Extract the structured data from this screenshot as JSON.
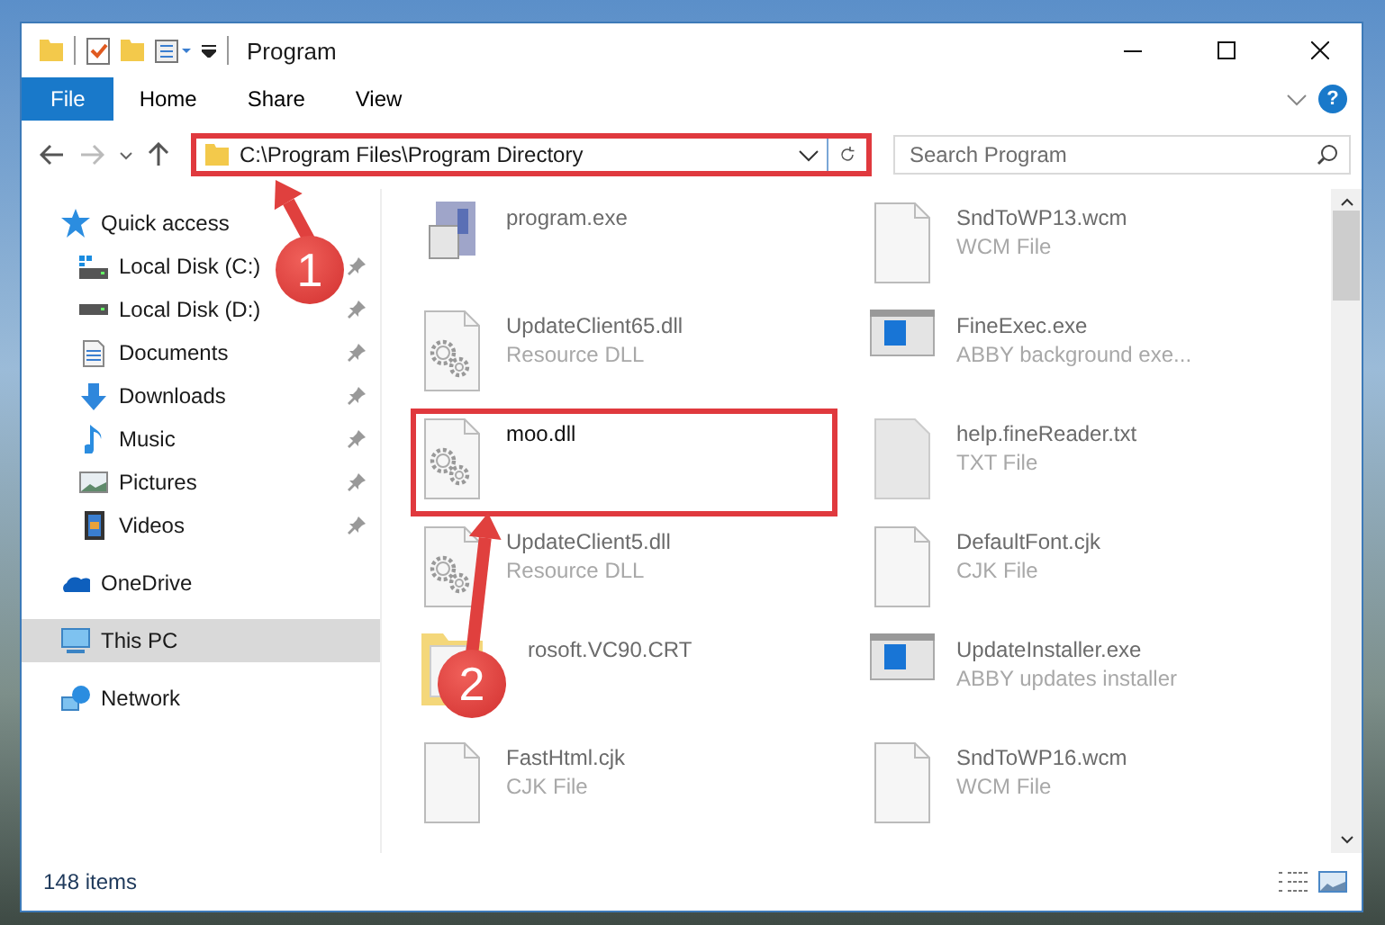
{
  "window": {
    "title": "Program",
    "help": "?"
  },
  "ribbon_tabs": [
    {
      "label": "File",
      "selected": true
    },
    {
      "label": "Home",
      "selected": false
    },
    {
      "label": "Share",
      "selected": false
    },
    {
      "label": "View",
      "selected": false
    }
  ],
  "address_bar": {
    "path": "C:\\Program Files\\Program Directory",
    "highlighted": true
  },
  "search": {
    "placeholder": "Search Program"
  },
  "sidebar": {
    "items": [
      {
        "label": "Quick access",
        "selected": false,
        "children": [
          {
            "label": "Local Disk (C:)",
            "pinned": true,
            "selected": false
          },
          {
            "label": "Local Disk (D:)",
            "pinned": true,
            "selected": false
          },
          {
            "label": "Documents",
            "pinned": true,
            "selected": false
          },
          {
            "label": "Downloads",
            "pinned": true,
            "selected": false
          },
          {
            "label": "Music",
            "pinned": true,
            "selected": false
          },
          {
            "label": "Pictures",
            "pinned": true,
            "selected": false
          },
          {
            "label": "Videos",
            "pinned": true,
            "selected": false
          }
        ]
      },
      {
        "label": "OneDrive",
        "selected": false
      },
      {
        "label": "This PC",
        "selected": true
      },
      {
        "label": "Network",
        "selected": false
      }
    ]
  },
  "files": [
    {
      "name": "program.exe",
      "highlighted": false
    },
    {
      "name": "SndToWP13.wcm",
      "type": "WCM File",
      "highlighted": false
    },
    {
      "name": "UpdateClient65.dll",
      "type": "Resource DLL",
      "highlighted": false
    },
    {
      "name": "FineExec.exe",
      "type": "ABBY background exe...",
      "highlighted": false
    },
    {
      "name": "moo.dll",
      "highlighted": true
    },
    {
      "name": "help.fineReader.txt",
      "type": "TXT File",
      "highlighted": false
    },
    {
      "name": "UpdateClient5.dll",
      "type": "Resource DLL",
      "highlighted": false
    },
    {
      "name": "DefaultFont.cjk",
      "type": "CJK File",
      "highlighted": false
    },
    {
      "name": "rosoft.VC90.CRT",
      "highlighted": false
    },
    {
      "name": "UpdateInstaller.exe",
      "type": "ABBY updates installer",
      "highlighted": false
    },
    {
      "name": "FastHtml.cjk",
      "type": "CJK File",
      "highlighted": false
    },
    {
      "name": "SndToWP16.wcm",
      "type": "WCM File",
      "highlighted": false
    }
  ],
  "annotations": [
    {
      "number": "1"
    },
    {
      "number": "2"
    }
  ],
  "status_bar": {
    "item_count": "148 items"
  }
}
